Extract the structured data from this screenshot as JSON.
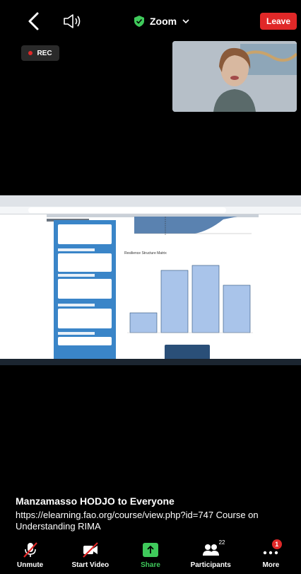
{
  "header": {
    "meeting_title": "Zoom",
    "leave_label": "Leave",
    "rec_label": "REC"
  },
  "shared_screen": {
    "chart_data": {
      "type": "bar",
      "title": "Resilience Structure Matrix",
      "categories": [
        "",
        "",
        "",
        ""
      ],
      "values": [
        0.28,
        0.88,
        0.95,
        0.67
      ],
      "ylim": [
        0,
        1
      ]
    }
  },
  "chat": {
    "sender": "Manzamasso HODJO to Everyone",
    "message": "https://elearning.fao.org/course/view.php?id=747 Course on Understanding RIMA"
  },
  "toolbar": {
    "items": [
      {
        "label": "Unmute"
      },
      {
        "label": "Start Video"
      },
      {
        "label": "Share"
      },
      {
        "label": "Participants",
        "count": "22"
      },
      {
        "label": "More",
        "badge": "1"
      }
    ]
  },
  "colors": {
    "leave": "#e02828",
    "share": "#3fca5b",
    "shield": "#3fca5b"
  }
}
